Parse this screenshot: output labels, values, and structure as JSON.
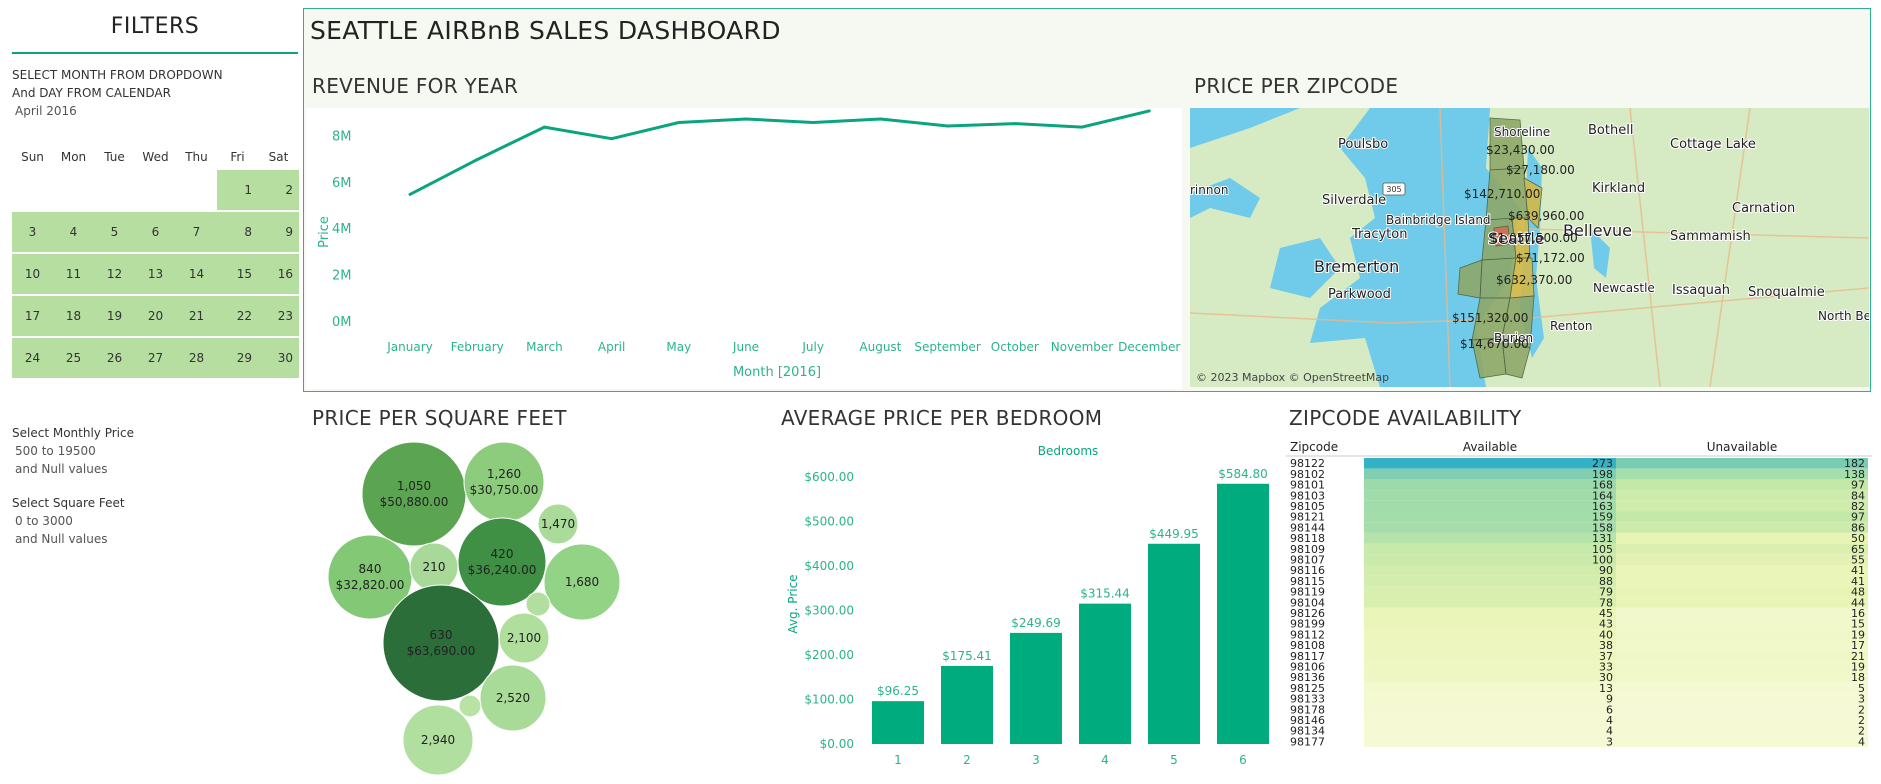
{
  "filters": {
    "title": "FILTERS",
    "instructions_line1": "SELECT MONTH FROM DROPDOWN",
    "instructions_line2": "And DAY FROM CALENDAR",
    "month_value": "April 2016",
    "weekdays": [
      "Sun",
      "Mon",
      "Tue",
      "Wed",
      "Thu",
      "Fri",
      "Sat"
    ],
    "days": [
      "1",
      "2",
      "3",
      "4",
      "5",
      "6",
      "7",
      "8",
      "9",
      "10",
      "11",
      "12",
      "13",
      "14",
      "15",
      "16",
      "17",
      "18",
      "19",
      "20",
      "21",
      "22",
      "23",
      "24",
      "25",
      "26",
      "27",
      "28",
      "29",
      "30"
    ],
    "price_label": "Select Monthly Price",
    "price_range": "500 to 19500",
    "price_null": "and Null values",
    "sqft_label": "Select Square Feet",
    "sqft_range": "0 to 3000",
    "sqft_null": "and Null values"
  },
  "dashboard": {
    "title": "SEATTLE AIRBnB SALES DASHBOARD",
    "revenue_title": "REVENUE FOR YEAR",
    "map_title": "PRICE PER ZIPCODE",
    "sqft_title": "PRICE PER SQUARE FEET",
    "bedroom_title": "AVERAGE PRICE PER BEDROOM",
    "zip_title": "ZIPCODE AVAILABILITY"
  },
  "map": {
    "places": [
      "Shoreline",
      "Bothell",
      "Cottage Lake",
      "Poulsbo",
      "Kirkland",
      "Carnation",
      "Silverdale",
      "Bainbridge Island",
      "Tracyton",
      "Bellevue",
      "Sammamish",
      "Bremerton",
      "Parkwood",
      "Newcastle",
      "Issaquah",
      "Snoqualmie",
      "North Bend",
      "Burien",
      "Renton",
      "Seattle",
      "rinnon"
    ],
    "price_labels": [
      "$23,430.00",
      "$27,180.00",
      "$142,710.00",
      "$639,960.00",
      "$1,057,500.00",
      "$71,172.00",
      "$632,370.00",
      "$151,320.00",
      "$14,670.00"
    ],
    "attribution": "© 2023 Mapbox © OpenStreetMap",
    "highway": "305",
    "colors": {
      "water": "#6fcbe9",
      "land": "#d6ebc3",
      "zip_green": "#8ea86a",
      "zip_yellow": "#d2b94a",
      "zip_red": "#d56b55"
    }
  },
  "chart_data": [
    {
      "type": "line",
      "title": "REVENUE FOR YEAR",
      "xlabel": "Month [2016]",
      "ylabel": "Price",
      "categories": [
        "January",
        "February",
        "March",
        "April",
        "May",
        "June",
        "July",
        "August",
        "September",
        "October",
        "November",
        "December"
      ],
      "values": [
        5.5,
        7.0,
        8.4,
        7.9,
        8.6,
        8.75,
        8.6,
        8.75,
        8.45,
        8.55,
        8.4,
        9.1
      ],
      "yticks": [
        "0M",
        "2M",
        "4M",
        "6M",
        "8M"
      ],
      "ylim": [
        0,
        9.5
      ],
      "value_units": "M",
      "color": "#0aa57f"
    },
    {
      "type": "scatter",
      "subtype": "packed-bubble",
      "title": "PRICE PER SQUARE FEET",
      "bubbles": [
        {
          "label": "1,050",
          "value_label": "$50,880.00",
          "value": 50880
        },
        {
          "label": "1,260",
          "value_label": "$30,750.00",
          "value": 30750
        },
        {
          "label": "1,470",
          "value_label": "",
          "value": 8000
        },
        {
          "label": "840",
          "value_label": "$32,820.00",
          "value": 32820
        },
        {
          "label": "210",
          "value_label": "",
          "value": 6000
        },
        {
          "label": "420",
          "value_label": "$36,240.00",
          "value": 36240
        },
        {
          "label": "1,680",
          "value_label": "",
          "value": 18000
        },
        {
          "label": "630",
          "value_label": "$63,690.00",
          "value": 63690
        },
        {
          "label": "",
          "value_label": "",
          "value": 1500
        },
        {
          "label": "2,100",
          "value_label": "",
          "value": 7500
        },
        {
          "label": "2,520",
          "value_label": "",
          "value": 13000
        },
        {
          "label": "",
          "value_label": "",
          "value": 1200
        },
        {
          "label": "2,940",
          "value_label": "",
          "value": 13500
        }
      ],
      "colors": [
        "#5ba552",
        "#8dcc7c",
        "#aadb9a",
        "#83c875",
        "#a8d998",
        "#3f8f45",
        "#93d385",
        "#2b6e3a",
        "#b2df9f",
        "#b0df9d",
        "#a9db98",
        "#b9e3a5",
        "#b0df9f"
      ]
    },
    {
      "type": "bar",
      "title": "AVERAGE PRICE PER BEDROOM",
      "legend_title": "Bedrooms",
      "ylabel": "Avg. Price",
      "categories": [
        "1",
        "2",
        "3",
        "4",
        "5",
        "6"
      ],
      "values": [
        96.25,
        175.41,
        249.69,
        315.44,
        449.95,
        584.8
      ],
      "value_labels": [
        "$96.25",
        "$175.41",
        "$249.69",
        "$315.44",
        "$449.95",
        "$584.80"
      ],
      "yticks": [
        "$0.00",
        "$100.00",
        "$200.00",
        "$300.00",
        "$400.00",
        "$500.00",
        "$600.00"
      ],
      "ylim": [
        0,
        600
      ],
      "color": "#00ab7e"
    },
    {
      "type": "table",
      "title": "ZIPCODE AVAILABILITY",
      "columns": [
        "Zipcode",
        "Available",
        "Unavailable"
      ],
      "rows": [
        [
          "98122",
          "273",
          "182"
        ],
        [
          "98102",
          "198",
          "138"
        ],
        [
          "98101",
          "168",
          "97"
        ],
        [
          "98103",
          "164",
          "84"
        ],
        [
          "98105",
          "163",
          "82"
        ],
        [
          "98121",
          "159",
          "97"
        ],
        [
          "98144",
          "158",
          "86"
        ],
        [
          "98118",
          "131",
          "50"
        ],
        [
          "98109",
          "105",
          "65"
        ],
        [
          "98107",
          "100",
          "55"
        ],
        [
          "98116",
          "90",
          "41"
        ],
        [
          "98115",
          "88",
          "41"
        ],
        [
          "98119",
          "79",
          "48"
        ],
        [
          "98104",
          "78",
          "44"
        ],
        [
          "98126",
          "45",
          "16"
        ],
        [
          "98199",
          "43",
          "15"
        ],
        [
          "98112",
          "40",
          "19"
        ],
        [
          "98108",
          "38",
          "17"
        ],
        [
          "98117",
          "37",
          "21"
        ],
        [
          "98106",
          "33",
          "19"
        ],
        [
          "98136",
          "30",
          "18"
        ],
        [
          "98125",
          "13",
          "5"
        ],
        [
          "98133",
          "9",
          "3"
        ],
        [
          "98178",
          "6",
          "2"
        ],
        [
          "98146",
          "4",
          "2"
        ],
        [
          "98134",
          "4",
          "2"
        ],
        [
          "98177",
          "3",
          "4"
        ]
      ]
    }
  ]
}
